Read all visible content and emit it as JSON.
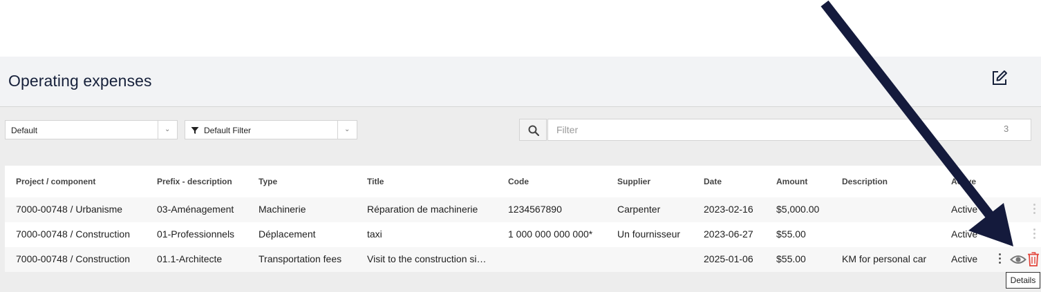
{
  "header": {
    "title": "Operating expenses"
  },
  "toolbar": {
    "view_select": "Default",
    "filter_select": "Default Filter",
    "filter_placeholder": "Filter",
    "result_count": "3"
  },
  "table": {
    "columns": [
      "Project / component",
      "Prefix - description",
      "Type",
      "Title",
      "Code",
      "Supplier",
      "Date",
      "Amount",
      "Description",
      "Active"
    ],
    "rows": [
      {
        "project": "7000-00748 / Urbanisme",
        "prefix": "03-Aménagement",
        "type": "Machinerie",
        "title": "Réparation de machinerie",
        "code": "1234567890",
        "supplier": "Carpenter",
        "date": "2023-02-16",
        "amount": "$5,000.00",
        "description": "",
        "active": "Active"
      },
      {
        "project": "7000-00748 / Construction",
        "prefix": "01-Professionnels",
        "type": "Déplacement",
        "title": "taxi",
        "code": "1 000 000 000 000*",
        "supplier": "Un fournisseur",
        "date": "2023-06-27",
        "amount": "$55.00",
        "description": "",
        "active": "Active"
      },
      {
        "project": "7000-00748 / Construction",
        "prefix": "01.1-Architecte",
        "type": "Transportation fees",
        "title": "Visit to the construction si…",
        "code": "",
        "supplier": "",
        "date": "2025-01-06",
        "amount": "$55.00",
        "description": "KM for personal car",
        "active": "Active"
      }
    ]
  },
  "tooltip": {
    "text": "Details"
  },
  "colors": {
    "accent_dark": "#16203a",
    "delete": "#e3443a",
    "arrow": "#141a3c"
  },
  "icons": [
    "edit-icon",
    "chevron-down-icon",
    "filter-icon",
    "search-icon",
    "kebab-menu-icon",
    "eye-icon",
    "trash-icon"
  ]
}
